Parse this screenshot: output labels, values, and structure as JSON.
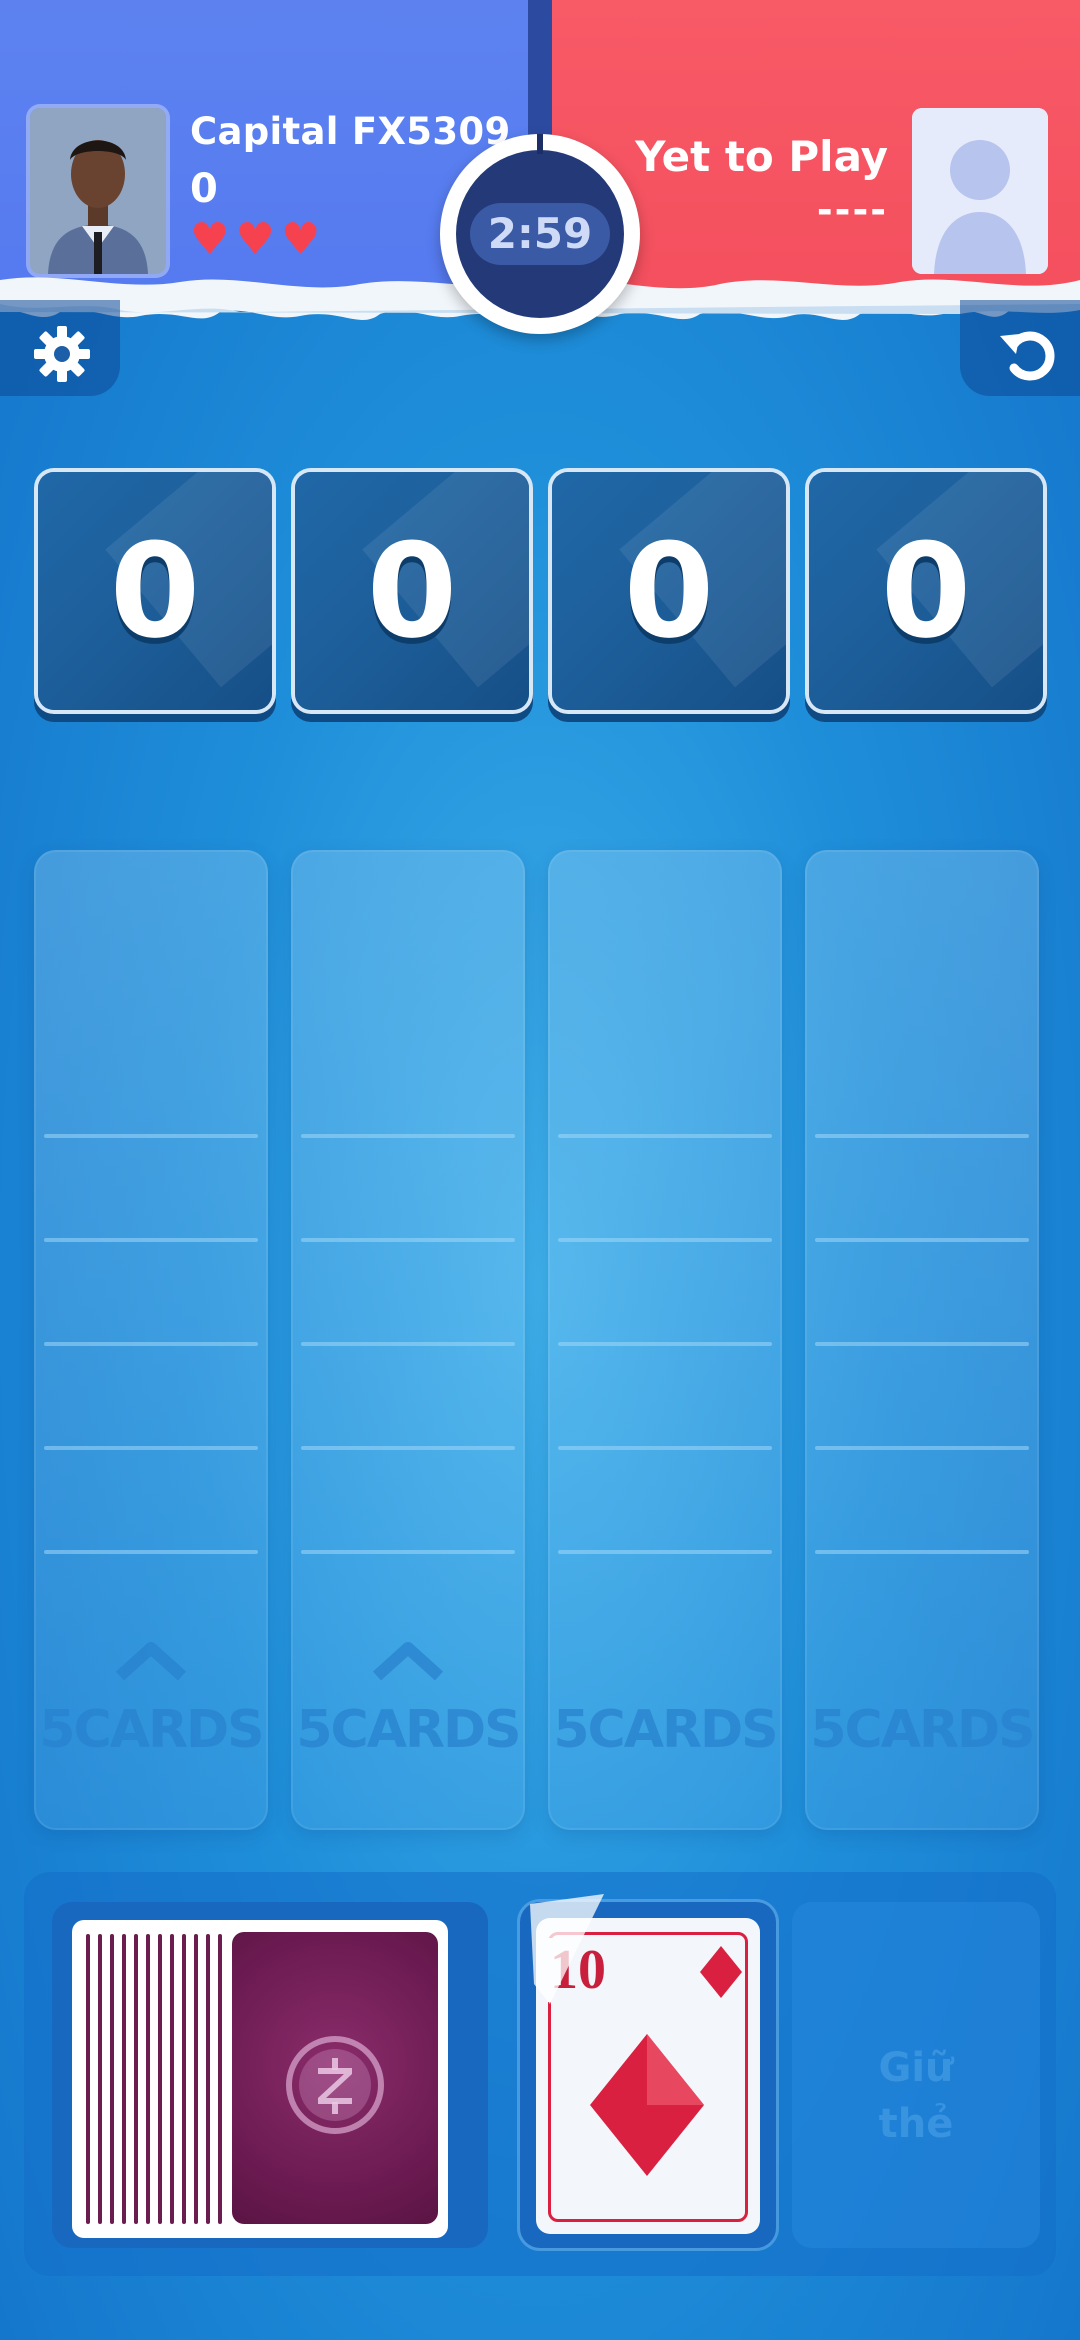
{
  "player": {
    "name": "Capital FX5309",
    "score": "0",
    "hearts": "♥♥♥"
  },
  "opponent": {
    "name": "Yet to Play",
    "score": "----"
  },
  "timer": "2:59",
  "score_tiles": [
    "0",
    "0",
    "0",
    "0"
  ],
  "columns": [
    {
      "label": "5CARDS",
      "chevron": true
    },
    {
      "label": "5CARDS",
      "chevron": true
    },
    {
      "label": "5CARDS",
      "chevron": false
    },
    {
      "label": "5CARDS",
      "chevron": false
    }
  ],
  "waste_card": {
    "rank": "10",
    "suit": "diamond"
  },
  "hold_label_line1": "Giữ",
  "hold_label_line2": "thẻ",
  "colors": {
    "player_panel": "#5d82f0",
    "opponent_panel": "#f44f5e",
    "card_red": "#d92040",
    "card_back": "#6a1a50"
  }
}
